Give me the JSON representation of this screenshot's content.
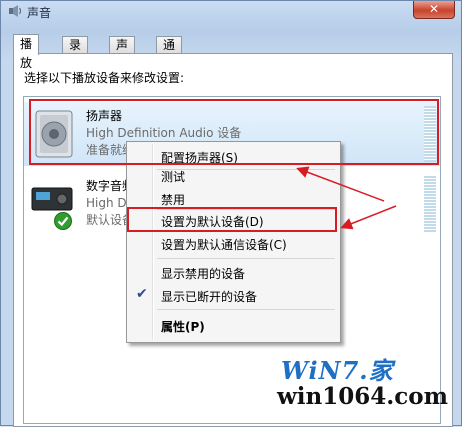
{
  "window": {
    "title": "声音",
    "close_label": "✕"
  },
  "tabs": [
    {
      "label": "播放",
      "active": true
    },
    {
      "label": "录制",
      "active": false
    },
    {
      "label": "声音",
      "active": false
    },
    {
      "label": "通信",
      "active": false
    }
  ],
  "panel": {
    "instruction": "选择以下播放设备来修改设置:"
  },
  "devices": [
    {
      "name": "扬声器",
      "subtitle": "High Definition Audio 设备",
      "status": "准备就绪",
      "icon": "speaker-icon",
      "selected": true
    },
    {
      "name": "数字音频",
      "subtitle": "High Definition Audio 设备",
      "status": "默认设备",
      "icon": "digital-audio-icon",
      "default_check": true,
      "selected": false
    }
  ],
  "context_menu": {
    "items": [
      {
        "label": "配置扬声器(S)"
      },
      {
        "label": "测试"
      },
      {
        "label": "禁用"
      },
      {
        "label": "设置为默认设备(D)",
        "highlighted_box": true
      },
      {
        "label": "设置为默认通信设备(C)"
      },
      {
        "label": "显示禁用的设备"
      },
      {
        "label": "显示已断开的设备",
        "checked": true
      },
      {
        "label": "属性(P)",
        "bold": true
      }
    ]
  },
  "watermark": {
    "brand": "WiN7.家",
    "site": "win1064.com"
  },
  "colors": {
    "annotation_red": "#d81c23",
    "selection": "#cfe5f8"
  }
}
